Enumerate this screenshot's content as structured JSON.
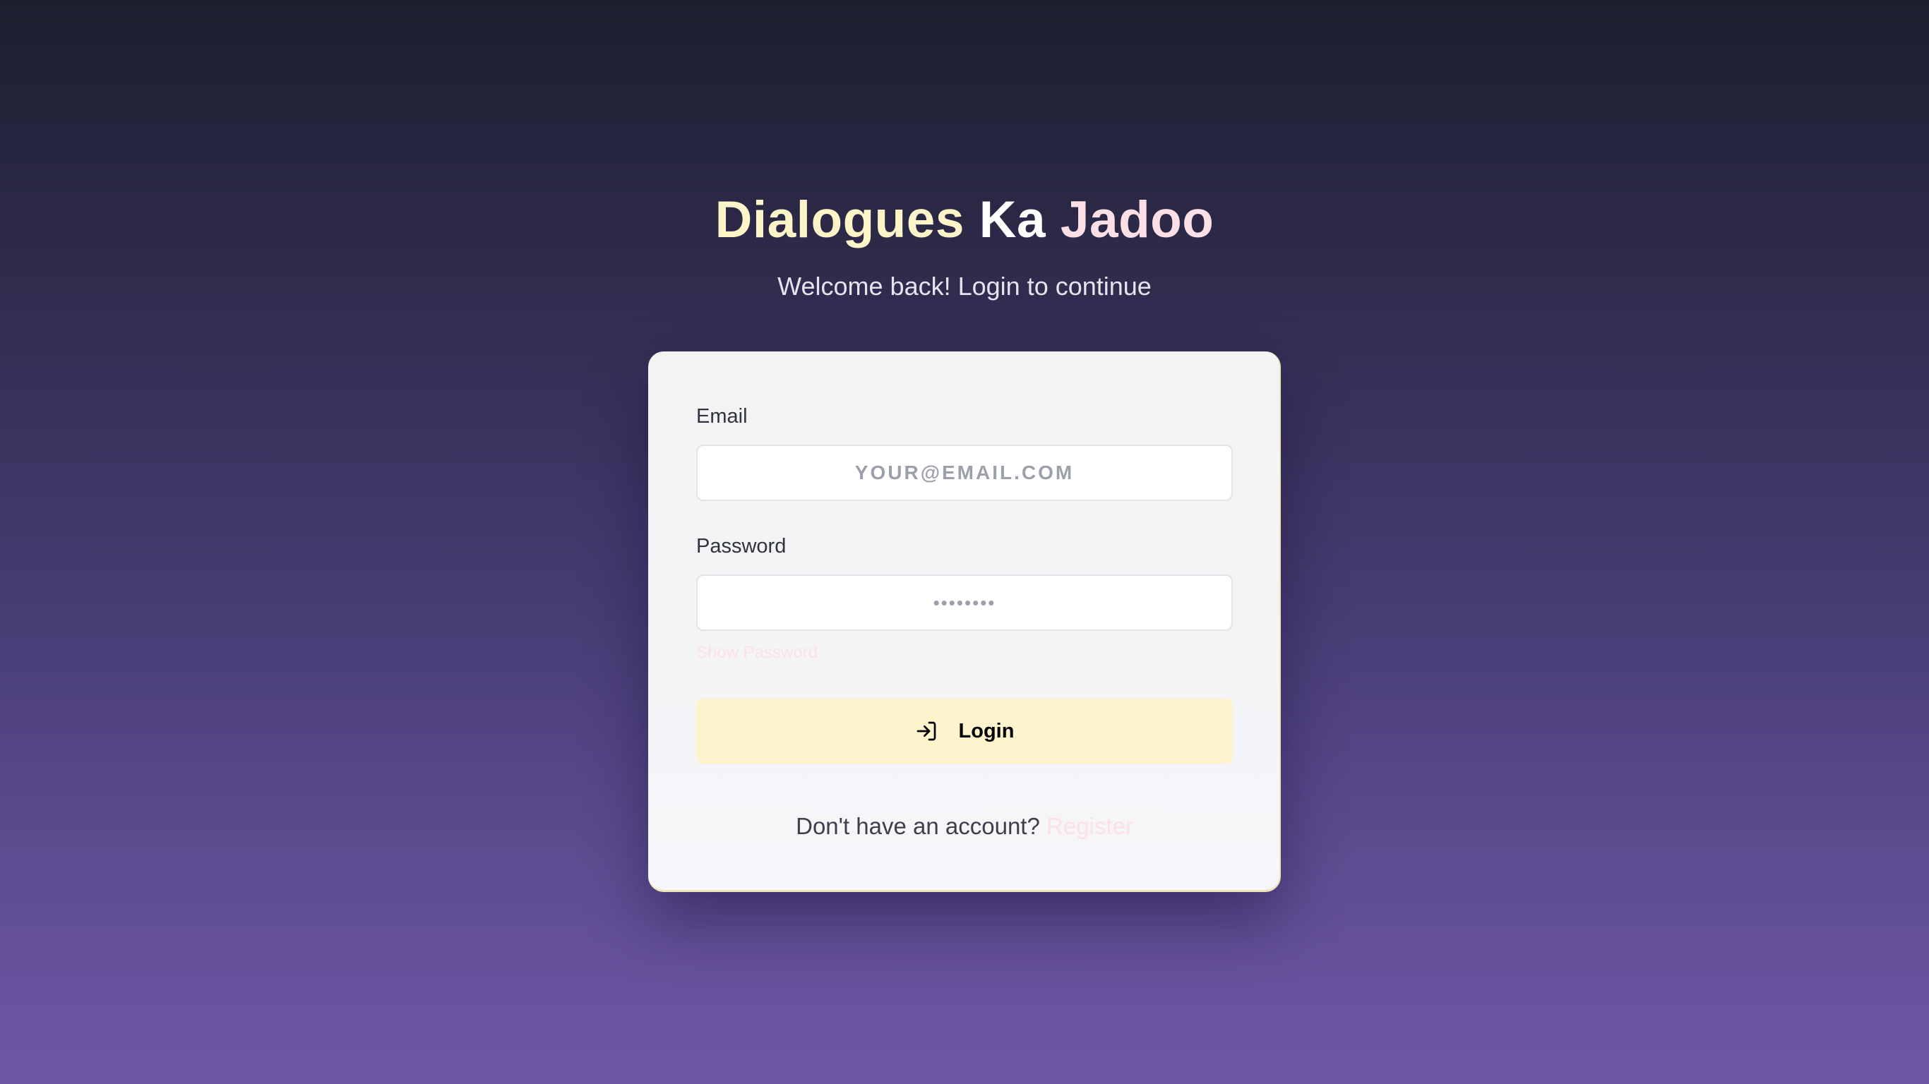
{
  "app": {
    "title_part1": "Dialogues",
    "title_part2": "Ka",
    "title_part3": "Jadoo",
    "subtitle": "Welcome back! Login to continue"
  },
  "form": {
    "email_label": "Email",
    "email_placeholder": "YOUR@EMAIL.COM",
    "email_value": "",
    "password_label": "Password",
    "password_placeholder": "••••••••",
    "password_value": "",
    "show_password": "Show Password",
    "login_button": "Login",
    "login_icon": "log-in-icon",
    "footer_text": "Don't have an account?",
    "register_link": "Register"
  },
  "colors": {
    "background_top": "#1c1f2e",
    "background_bottom": "#6e57a6",
    "title_accent_1": "#fdf4c7",
    "title_accent_2": "#ffffff",
    "title_accent_3": "#fde0e6",
    "button_bg": "#fdf4cd",
    "link": "#fde0e6",
    "card_bg": "#f4f4f6"
  }
}
